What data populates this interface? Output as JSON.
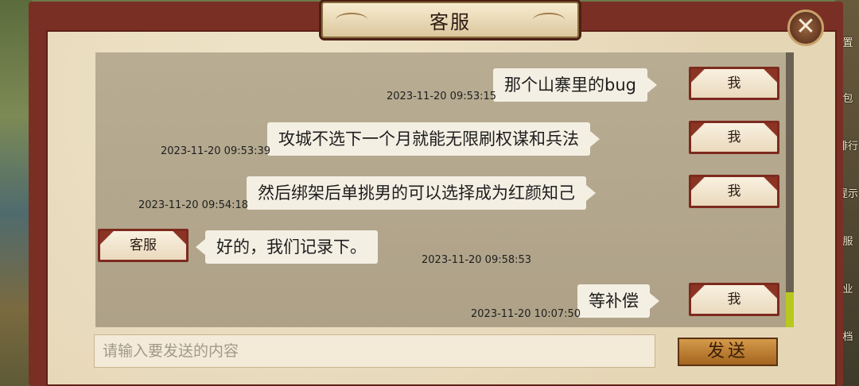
{
  "dialog": {
    "title": "客服",
    "close_symbol": "✕"
  },
  "side_menu": [
    "置",
    "包",
    "排行",
    "提示",
    "服",
    "业",
    "档"
  ],
  "messages": [
    {
      "sender": "我",
      "text": "那个山寨里的bug",
      "time": "2023-11-20 09:53:15"
    },
    {
      "sender": "我",
      "text": "攻城不选下一个月就能无限刷权谋和兵法",
      "time": "2023-11-20 09:53:39"
    },
    {
      "sender": "我",
      "text": "然后绑架后单挑男的可以选择成为红颜知己",
      "time": "2023-11-20 09:54:18"
    },
    {
      "sender": "客服",
      "text": "好的，我们记录下。",
      "time": "2023-11-20  09:58:53"
    },
    {
      "sender": "我",
      "text": "等补偿",
      "time": "2023-11-20 10:07:50"
    }
  ],
  "input": {
    "placeholder": "请输入要发送的内容"
  },
  "send_button": {
    "label": "发送"
  },
  "colors": {
    "frame": "#7a2f24",
    "panel": "#e9dcbf",
    "chat_bg": "#b5a98f",
    "scroll_thumb": "#b8c81e"
  }
}
